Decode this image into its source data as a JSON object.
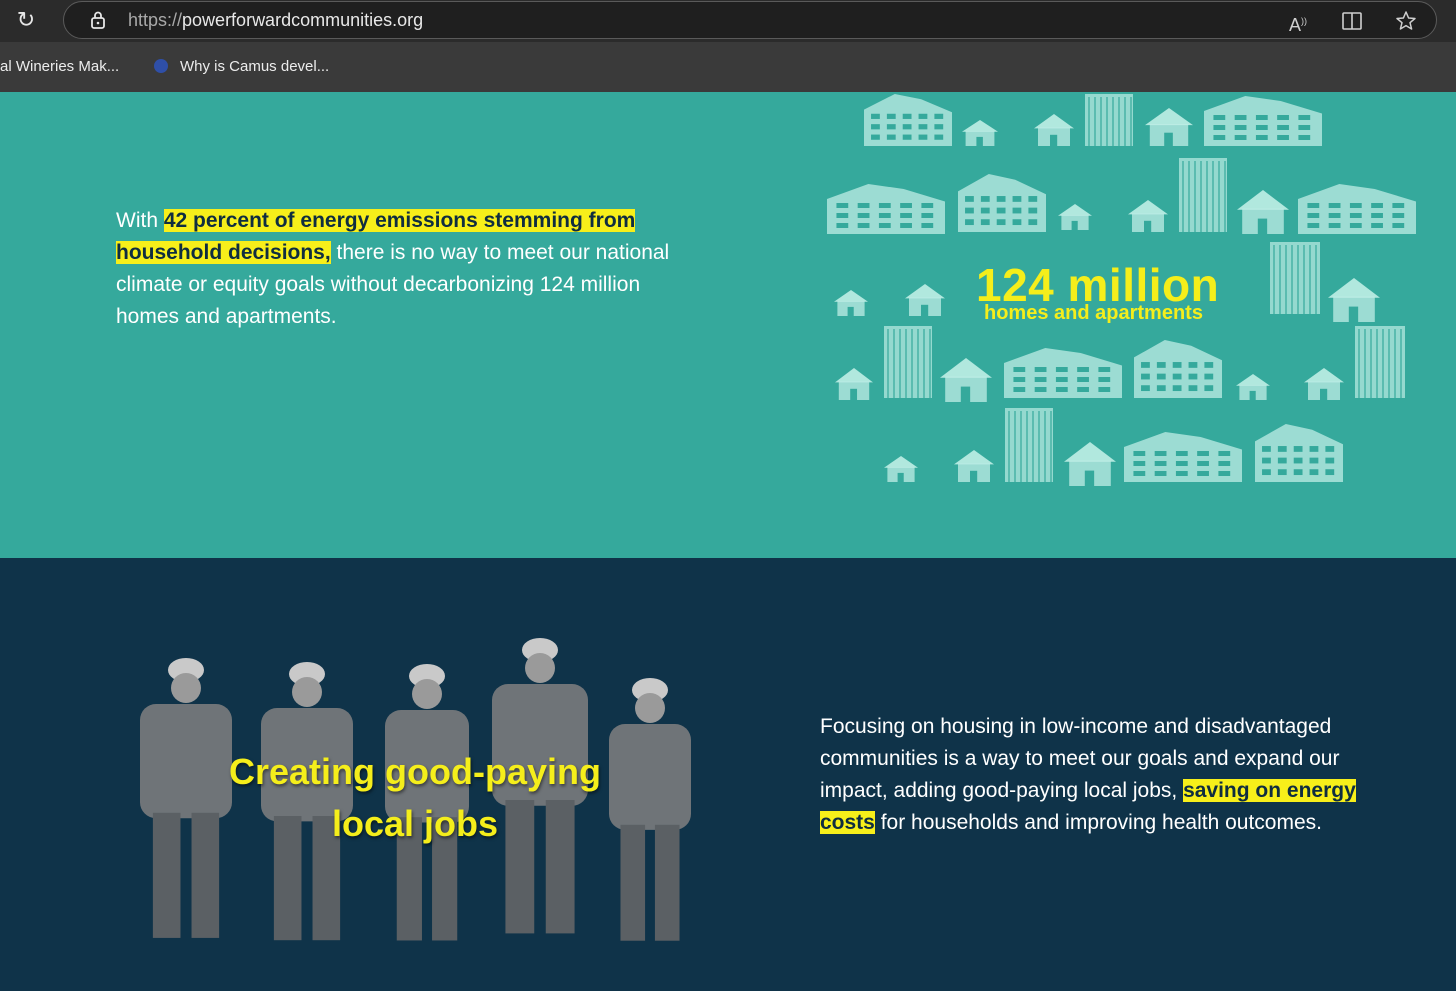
{
  "browser": {
    "url_scheme": "https://",
    "url_host": "powerforwardcommunities.org",
    "bookmarks": [
      {
        "label": "al Wineries Mak..."
      },
      {
        "label": "Why is Camus devel..."
      }
    ]
  },
  "section_emissions": {
    "prefix": "With ",
    "highlight": "42 percent of energy emissions stemming from household decisions,",
    "rest": " there is no way to meet our national climate or equity goals without decarbonizing 124 million homes and apartments.",
    "stat_number": "124 million",
    "stat_label": "homes and apartments"
  },
  "section_jobs": {
    "image_title_line1": "Creating good-paying",
    "image_title_line2": "local jobs",
    "text_before": "Focusing on housing in low-income and disadvantaged communities is a way to meet our goals and expand our impact, adding good-paying local jobs, ",
    "highlight": "saving on energy costs",
    "text_after": " for households and improving health outcomes."
  },
  "colors": {
    "teal": "#35a99c",
    "navy": "#0f3349",
    "highlight_yellow": "#f7ef1a"
  }
}
